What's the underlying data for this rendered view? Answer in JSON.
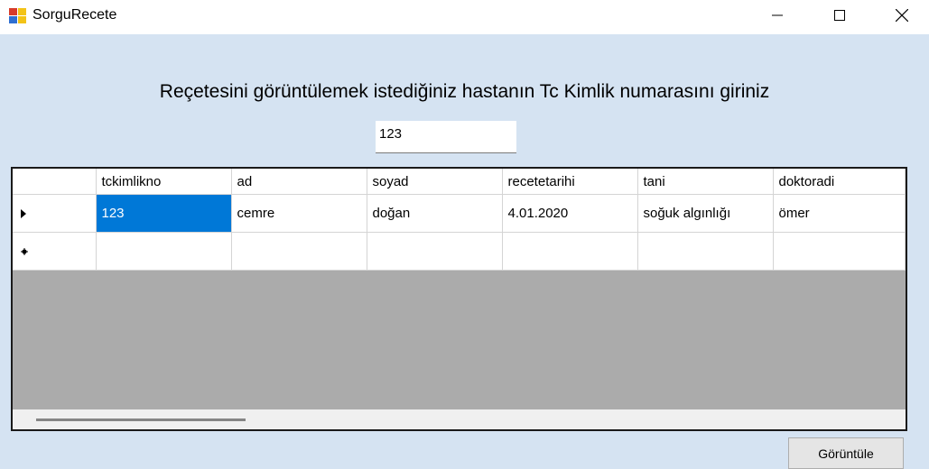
{
  "window": {
    "title": "SorguRecete"
  },
  "form": {
    "prompt": "Reçetesini görüntülemek istediğiniz hastanın Tc Kimlik numarasını giriniz",
    "tc_value": "123",
    "button_label": "Görüntüle"
  },
  "grid": {
    "columns": [
      "tckimlikno",
      "ad",
      "soyad",
      "recetetarihi",
      "tani",
      "doktoradi"
    ],
    "rows": [
      [
        "123",
        "cemre",
        "doğan",
        "4.01.2020",
        "soğuk algınlığı",
        "ömer"
      ]
    ],
    "selected_cell": "tckimlikno",
    "new_row_marker": "*"
  },
  "colors": {
    "client_bg": "#d5e3f2",
    "selection": "#0078d7",
    "grid_empty_bg": "#ababab"
  }
}
